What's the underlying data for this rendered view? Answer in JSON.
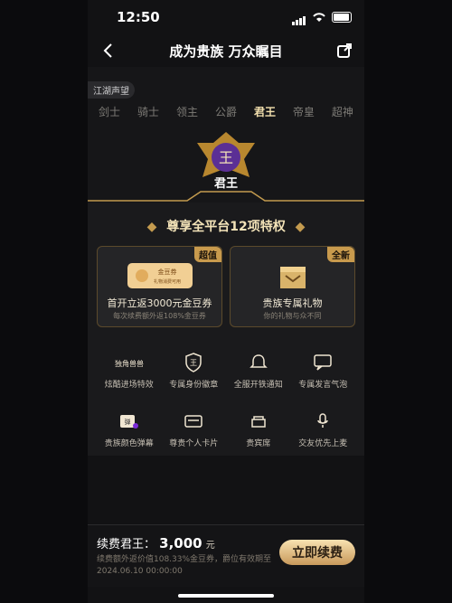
{
  "status_bar": {
    "time": "12:50"
  },
  "nav": {
    "title": "成为贵族 万众瞩目"
  },
  "hero": {
    "tag": "江湖声望",
    "tabs": [
      "剑士",
      "骑士",
      "领主",
      "公爵",
      "君王",
      "帝皇",
      "超神"
    ],
    "active_index": 4,
    "rank_title": "君王"
  },
  "privileges": {
    "title": "尊享全平台12项特权",
    "cards": [
      {
        "badge": "超值",
        "coupon_label": "金豆券",
        "coupon_note": "礼物消费可用",
        "main": "首开立返3000元金豆券",
        "sub": "每次续费额外返108%金豆券"
      },
      {
        "badge": "全新",
        "main": "贵族专属礼物",
        "sub": "你的礼物与众不同"
      }
    ],
    "items": [
      {
        "label": "炫酷进场特效",
        "icon_text": "独角兽兽"
      },
      {
        "label": "专属身份徽章",
        "icon_text": "王"
      },
      {
        "label": "全服开铁通知"
      },
      {
        "label": "专属发言气泡"
      },
      {
        "label": "贵族颜色弹幕",
        "icon_text": "弹"
      },
      {
        "label": "尊贵个人卡片"
      },
      {
        "label": "贵宾席"
      },
      {
        "label": "交友优先上麦"
      }
    ]
  },
  "bottom_bar": {
    "prefix": "续费君王：",
    "amount": "3,000",
    "unit": "元",
    "note_line1": "续费额外返价值108.33%金豆券，爵位有效期至",
    "note_line2": "2024.06.10 00:00:00",
    "cta": "立即续费"
  }
}
